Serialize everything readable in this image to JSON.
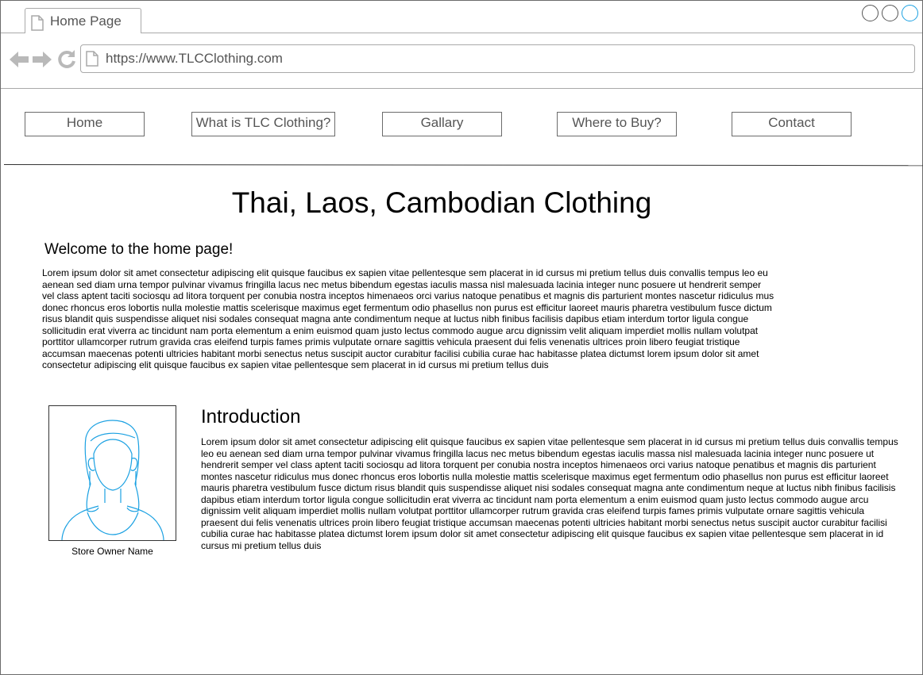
{
  "browser": {
    "tab_title": "Home Page",
    "url": "https://www.TLCClothing.com"
  },
  "nav": {
    "items": [
      {
        "label": "Home"
      },
      {
        "label": "What is TLC Clothing?"
      },
      {
        "label": "Gallary"
      },
      {
        "label": "Where to Buy?"
      },
      {
        "label": "Contact"
      }
    ]
  },
  "main": {
    "title": "Thai, Laos, Cambodian Clothing",
    "welcome": "Welcome to the home page!",
    "welcome_text": "Lorem ipsum dolor sit amet consectetur adipiscing elit quisque faucibus ex sapien vitae pellentesque sem placerat in id cursus mi pretium tellus duis convallis tempus leo eu aenean sed diam urna tempor pulvinar vivamus fringilla lacus nec metus bibendum egestas iaculis massa nisl malesuada lacinia integer nunc posuere ut hendrerit semper vel class aptent taciti sociosqu ad litora torquent per conubia nostra inceptos himenaeos orci varius natoque penatibus et magnis dis parturient montes nascetur ridiculus mus donec rhoncus eros lobortis nulla molestie mattis scelerisque maximus eget fermentum odio phasellus non purus est efficitur laoreet mauris pharetra vestibulum fusce dictum risus blandit quis suspendisse aliquet nisi sodales consequat magna ante condimentum neque at luctus nibh finibus facilisis dapibus etiam interdum tortor ligula congue sollicitudin erat viverra ac tincidunt nam porta elementum a enim euismod quam justo lectus commodo augue arcu dignissim velit aliquam imperdiet mollis nullam volutpat porttitor ullamcorper rutrum gravida cras eleifend turpis fames primis vulputate ornare sagittis vehicula praesent dui felis venenatis ultrices proin libero feugiat tristique accumsan maecenas potenti ultricies habitant morbi senectus netus suscipit auctor curabitur facilisi cubilia curae hac habitasse platea dictumst lorem ipsum dolor sit amet consectetur adipiscing elit quisque faucibus ex sapien vitae pellentesque sem placerat in id cursus mi pretium tellus duis",
    "owner_caption": "Store Owner Name",
    "intro_heading": "Introduction",
    "intro_text": "Lorem ipsum dolor sit amet consectetur adipiscing elit quisque faucibus ex sapien vitae pellentesque sem placerat in id cursus mi pretium tellus duis convallis tempus leo eu aenean sed diam urna tempor pulvinar vivamus fringilla lacus nec metus bibendum egestas iaculis massa nisl malesuada lacinia integer nunc posuere ut hendrerit semper vel class aptent taciti sociosqu ad litora torquent per conubia nostra inceptos himenaeos orci varius natoque penatibus et magnis dis parturient montes nascetur ridiculus mus donec rhoncus eros lobortis nulla molestie mattis scelerisque maximus eget fermentum odio phasellus non purus est efficitur laoreet mauris pharetra vestibulum fusce dictum risus blandit quis suspendisse aliquet nisi sodales consequat magna ante condimentum neque at luctus nibh finibus facilisis dapibus etiam interdum tortor ligula congue sollicitudin erat viverra ac tincidunt nam porta elementum a enim euismod quam justo lectus commodo augue arcu dignissim velit aliquam imperdiet mollis nullam volutpat porttitor ullamcorper rutrum gravida cras eleifend turpis fames primis vulputate ornare sagittis vehicula praesent dui felis venenatis ultrices proin libero feugiat tristique accumsan maecenas potenti ultricies habitant morbi senectus netus suscipit auctor curabitur facilisi cubilia curae hac habitasse platea dictumst lorem ipsum dolor sit amet consectetur adipiscing elit quisque faucibus ex sapien vitae pellentesque sem placerat in id cursus mi pretium tellus duis"
  },
  "icons": {
    "tab": "document-icon",
    "back": "back-arrow-icon",
    "forward": "forward-arrow-icon",
    "reload": "reload-icon",
    "address": "document-icon",
    "portrait": "person-icon"
  },
  "colors": {
    "chrome_gray": "#a9a9a9",
    "accent_blue": "#1ba1e2",
    "portrait_stroke": "#1ba1e2"
  }
}
